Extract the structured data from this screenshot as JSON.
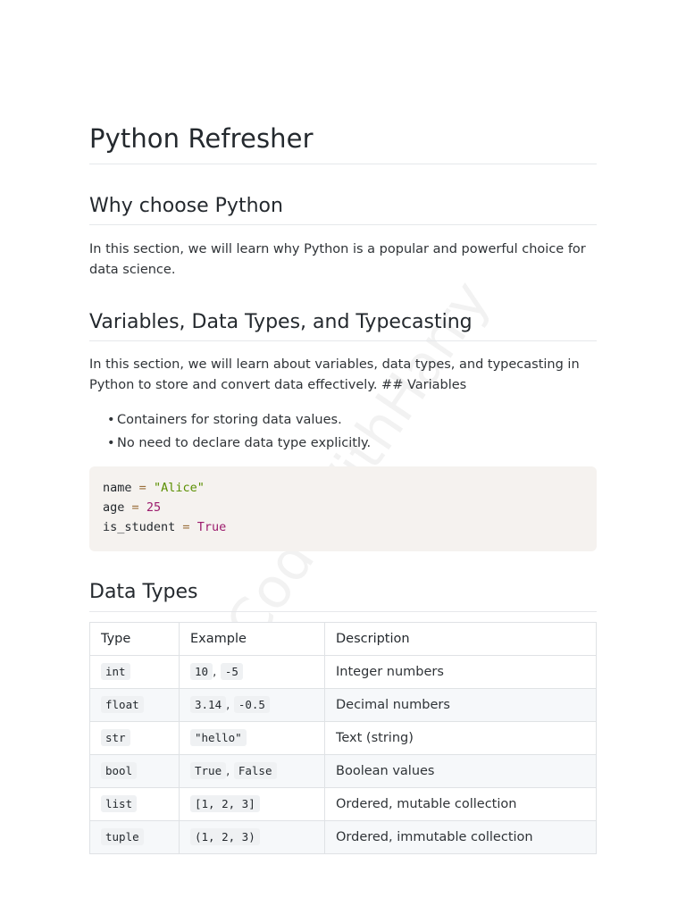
{
  "doc": {
    "title": "Python Refresher",
    "watermark": "CodeWithHarry"
  },
  "sections": {
    "why": {
      "heading": "Why choose Python",
      "text": "In this section, we will learn why Python is a popular and powerful choice for data science."
    },
    "variables": {
      "heading": "Variables, Data Types, and Typecasting",
      "text": "In this section, we will learn about variables, data types, and typecasting in Python to store and convert data effectively. ## Variables",
      "bullets": [
        "Containers for storing data values.",
        "No need to declare data type explicitly."
      ],
      "code": {
        "line1": {
          "name": "name",
          "op": "=",
          "value": "\"Alice\""
        },
        "line2": {
          "name": "age",
          "op": "=",
          "value": "25"
        },
        "line3": {
          "name": "is_student",
          "op": "=",
          "value": "True"
        }
      }
    },
    "datatypes": {
      "heading": "Data Types",
      "table": {
        "headers": [
          "Type",
          "Example",
          "Description"
        ],
        "rows": [
          {
            "type": "int",
            "ex1": "10",
            "ex2": "-5",
            "desc": "Integer numbers"
          },
          {
            "type": "float",
            "ex1": "3.14",
            "ex2": "-0.5",
            "desc": "Decimal numbers"
          },
          {
            "type": "str",
            "ex1": "\"hello\"",
            "ex2": "",
            "desc": "Text (string)"
          },
          {
            "type": "bool",
            "ex1": "True",
            "ex2": "False",
            "desc": "Boolean values"
          },
          {
            "type": "list",
            "ex1": "[1, 2, 3]",
            "ex2": "",
            "desc": "Ordered, mutable collection"
          },
          {
            "type": "tuple",
            "ex1": "(1, 2, 3)",
            "ex2": "",
            "desc": "Ordered, immutable collection"
          }
        ],
        "separator": ","
      }
    }
  }
}
